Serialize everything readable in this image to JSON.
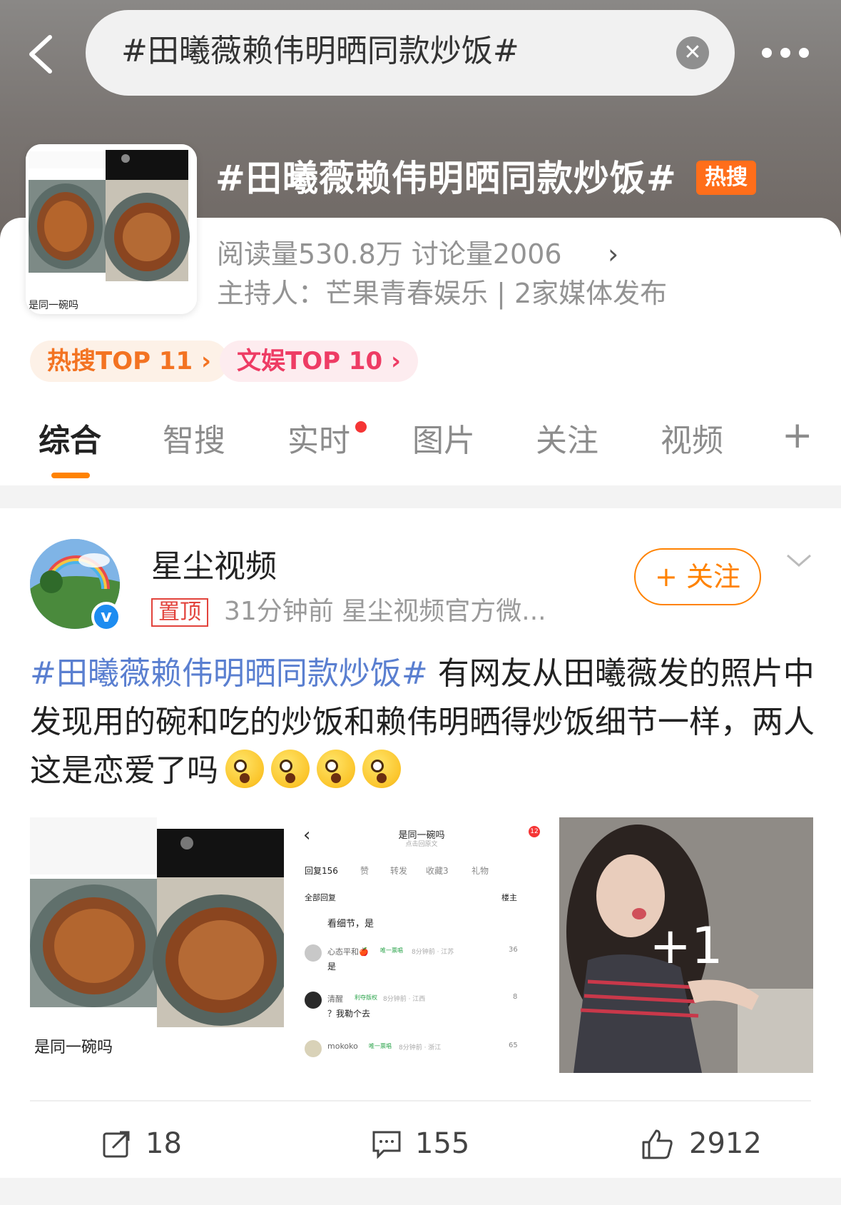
{
  "header": {
    "search_query": "#田曦薇赖伟明晒同款炒饭#"
  },
  "topic": {
    "title": "#田曦薇赖伟明晒同款炒饭#",
    "badge": "热搜",
    "stats": "阅读量530.8万  讨论量2006",
    "host": "主持人：芒果青春娱乐 | 2家媒体发布",
    "thumb_caption": "是同一碗吗"
  },
  "rank_pills": [
    "热搜TOP 11 ›",
    "文娱TOP 10 ›"
  ],
  "tabs": [
    "综合",
    "智搜",
    "实时",
    "图片",
    "关注",
    "视频",
    "+"
  ],
  "post": {
    "username": "星尘视频",
    "pinned_label": "置顶",
    "meta": "31分钟前  星尘视频官方微...",
    "follow_label": "+ 关注",
    "hashtag": "#田曦薇赖伟明晒同款炒饭#",
    "body": " 有网友从田曦薇发的照片中发现用的碗和吃的炒饭和赖伟明晒得炒饭细节一样，两人这是恋爱了吗",
    "emoji": "face-surprised-icon",
    "image1_caption": "是同一碗吗",
    "image2": {
      "title": "是同一碗吗",
      "subtitle": "点击回原文",
      "badge": "12",
      "tabs": [
        "回复156",
        "赞",
        "转发",
        "收藏3",
        "礼物"
      ],
      "section": "全部回复",
      "section_tag": "楼主",
      "comments": [
        {
          "name": "",
          "text": "看细节，是",
          "likes": ""
        },
        {
          "name": "心态平和🍎",
          "tag": "唯一票唱",
          "meta": "8分钟前 · 江苏",
          "text": "是",
          "likes": "36"
        },
        {
          "name": "清醒",
          "tag": "利夺版权",
          "meta": "8分钟前 · 江西",
          "text": "？我勒个去",
          "likes": "8"
        },
        {
          "name": "mokoko",
          "tag": "唯一票唱",
          "meta": "8分钟前 · 浙江",
          "text": "",
          "likes": "65"
        }
      ]
    },
    "more_images": "+1",
    "actions": {
      "repost": "18",
      "comments": "155",
      "likes": "2912"
    }
  },
  "colors": {
    "accent": "#ff8200",
    "link": "#5a7fd0",
    "hot": "#ff6e1a",
    "pinned": "#e2433c"
  }
}
